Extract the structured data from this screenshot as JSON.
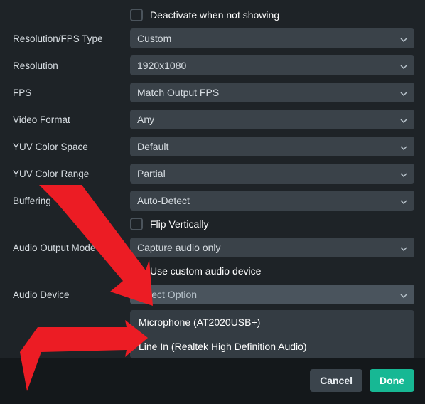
{
  "checkboxes": {
    "deactivate_label": "Deactivate when not showing",
    "flip_label": "Flip Vertically",
    "custom_audio_label": "Use custom audio device"
  },
  "labels": {
    "resolution_fps_type": "Resolution/FPS Type",
    "resolution": "Resolution",
    "fps": "FPS",
    "video_format": "Video Format",
    "yuv_color_space": "YUV Color Space",
    "yuv_color_range": "YUV Color Range",
    "buffering": "Buffering",
    "audio_output_mode": "Audio Output Mode",
    "audio_device": "Audio Device"
  },
  "values": {
    "resolution_fps_type": "Custom",
    "resolution": "1920x1080",
    "fps": "Match Output FPS",
    "video_format": "Any",
    "yuv_color_space": "Default",
    "yuv_color_range": "Partial",
    "buffering": "Auto-Detect",
    "audio_output_mode": "Capture audio only",
    "audio_device_placeholder": "Select Option"
  },
  "dropdown_options": {
    "audio_device": [
      "Microphone (AT2020USB+)",
      "Line In (Realtek High Definition Audio)"
    ]
  },
  "footer": {
    "cancel": "Cancel",
    "done": "Done"
  }
}
